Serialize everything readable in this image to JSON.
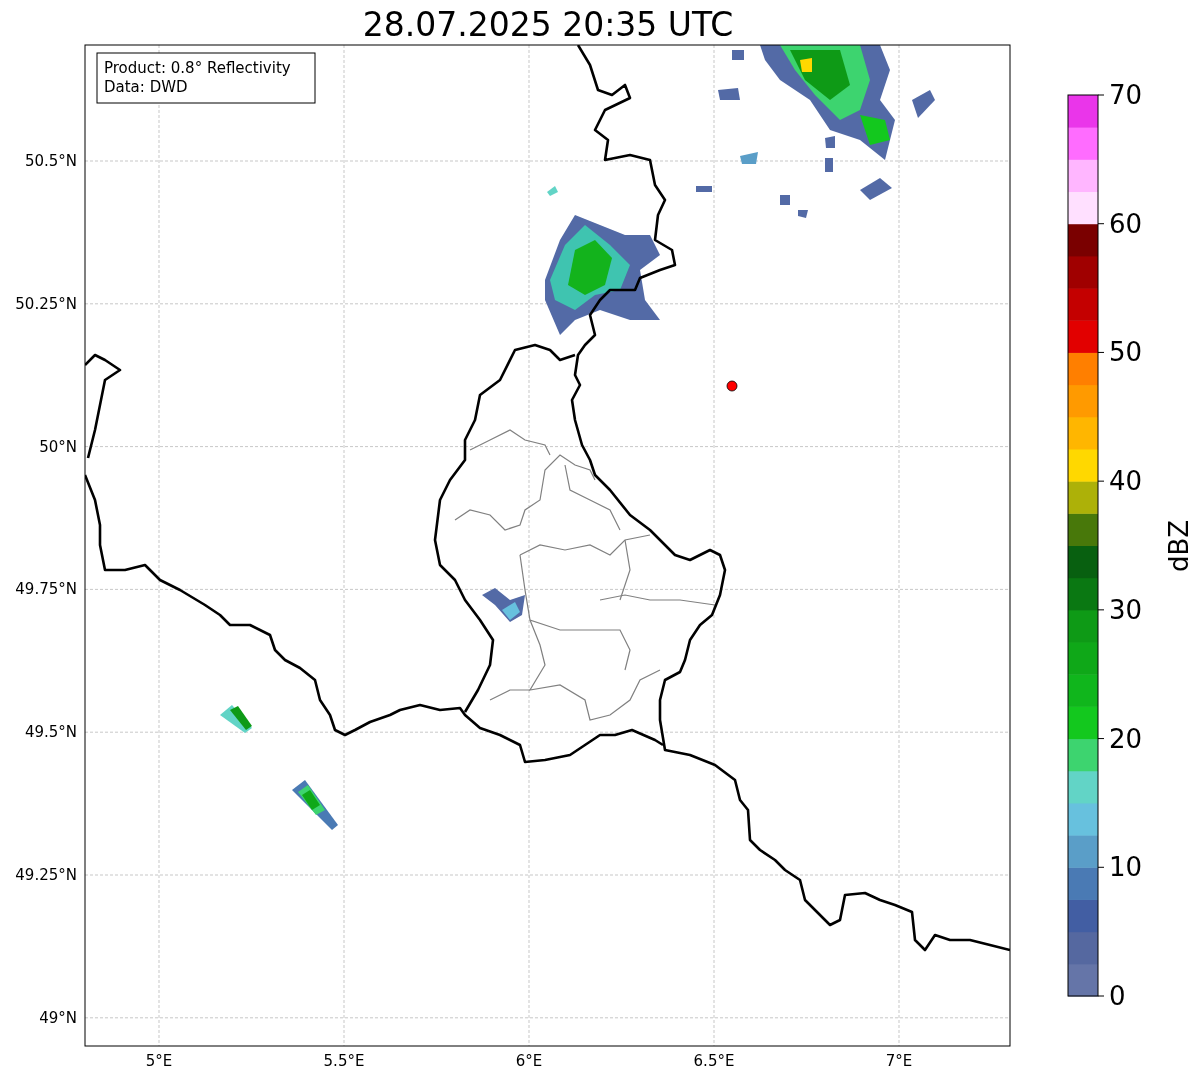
{
  "title": "28.07.2025 20:35 UTC",
  "info_box": [
    "Product: 0.8° Reflectivity",
    "Data: DWD"
  ],
  "lat_labels": [
    "50.5°N",
    "50.25°N",
    "50°N",
    "49.75°N",
    "49.5°N",
    "49.25°N",
    "49°N"
  ],
  "lon_labels": [
    "5°E",
    "5.5°E",
    "6°E",
    "6.5°E",
    "7°E"
  ],
  "map": {
    "kind": "map"
  },
  "colorbar": {
    "label": "dBZ",
    "ticks": [
      "70",
      "60",
      "50",
      "40",
      "30",
      "20",
      "10",
      "0"
    ],
    "bands": [
      {
        "color": "#6575a8"
      },
      {
        "color": "#5568a0"
      },
      {
        "color": "#425ea3"
      },
      {
        "color": "#4a7ab4"
      },
      {
        "color": "#5a9ec8"
      },
      {
        "color": "#67c1de"
      },
      {
        "color": "#62d4c6"
      },
      {
        "color": "#3dd46f"
      },
      {
        "color": "#13c81e"
      },
      {
        "color": "#10b61c"
      },
      {
        "color": "#0fa818"
      },
      {
        "color": "#0e9a16"
      },
      {
        "color": "#0a7812"
      },
      {
        "color": "#086010"
      },
      {
        "color": "#48780a"
      },
      {
        "color": "#adb108"
      },
      {
        "color": "#ffd800"
      },
      {
        "color": "#ffb600"
      },
      {
        "color": "#ff9a00"
      },
      {
        "color": "#ff7f00"
      },
      {
        "color": "#e20000"
      },
      {
        "color": "#c40000"
      },
      {
        "color": "#a00000"
      },
      {
        "color": "#7a0000"
      },
      {
        "color": "#ffe0ff"
      },
      {
        "color": "#ffb6ff"
      },
      {
        "color": "#ff6cff"
      },
      {
        "color": "#ea35ea"
      }
    ]
  }
}
